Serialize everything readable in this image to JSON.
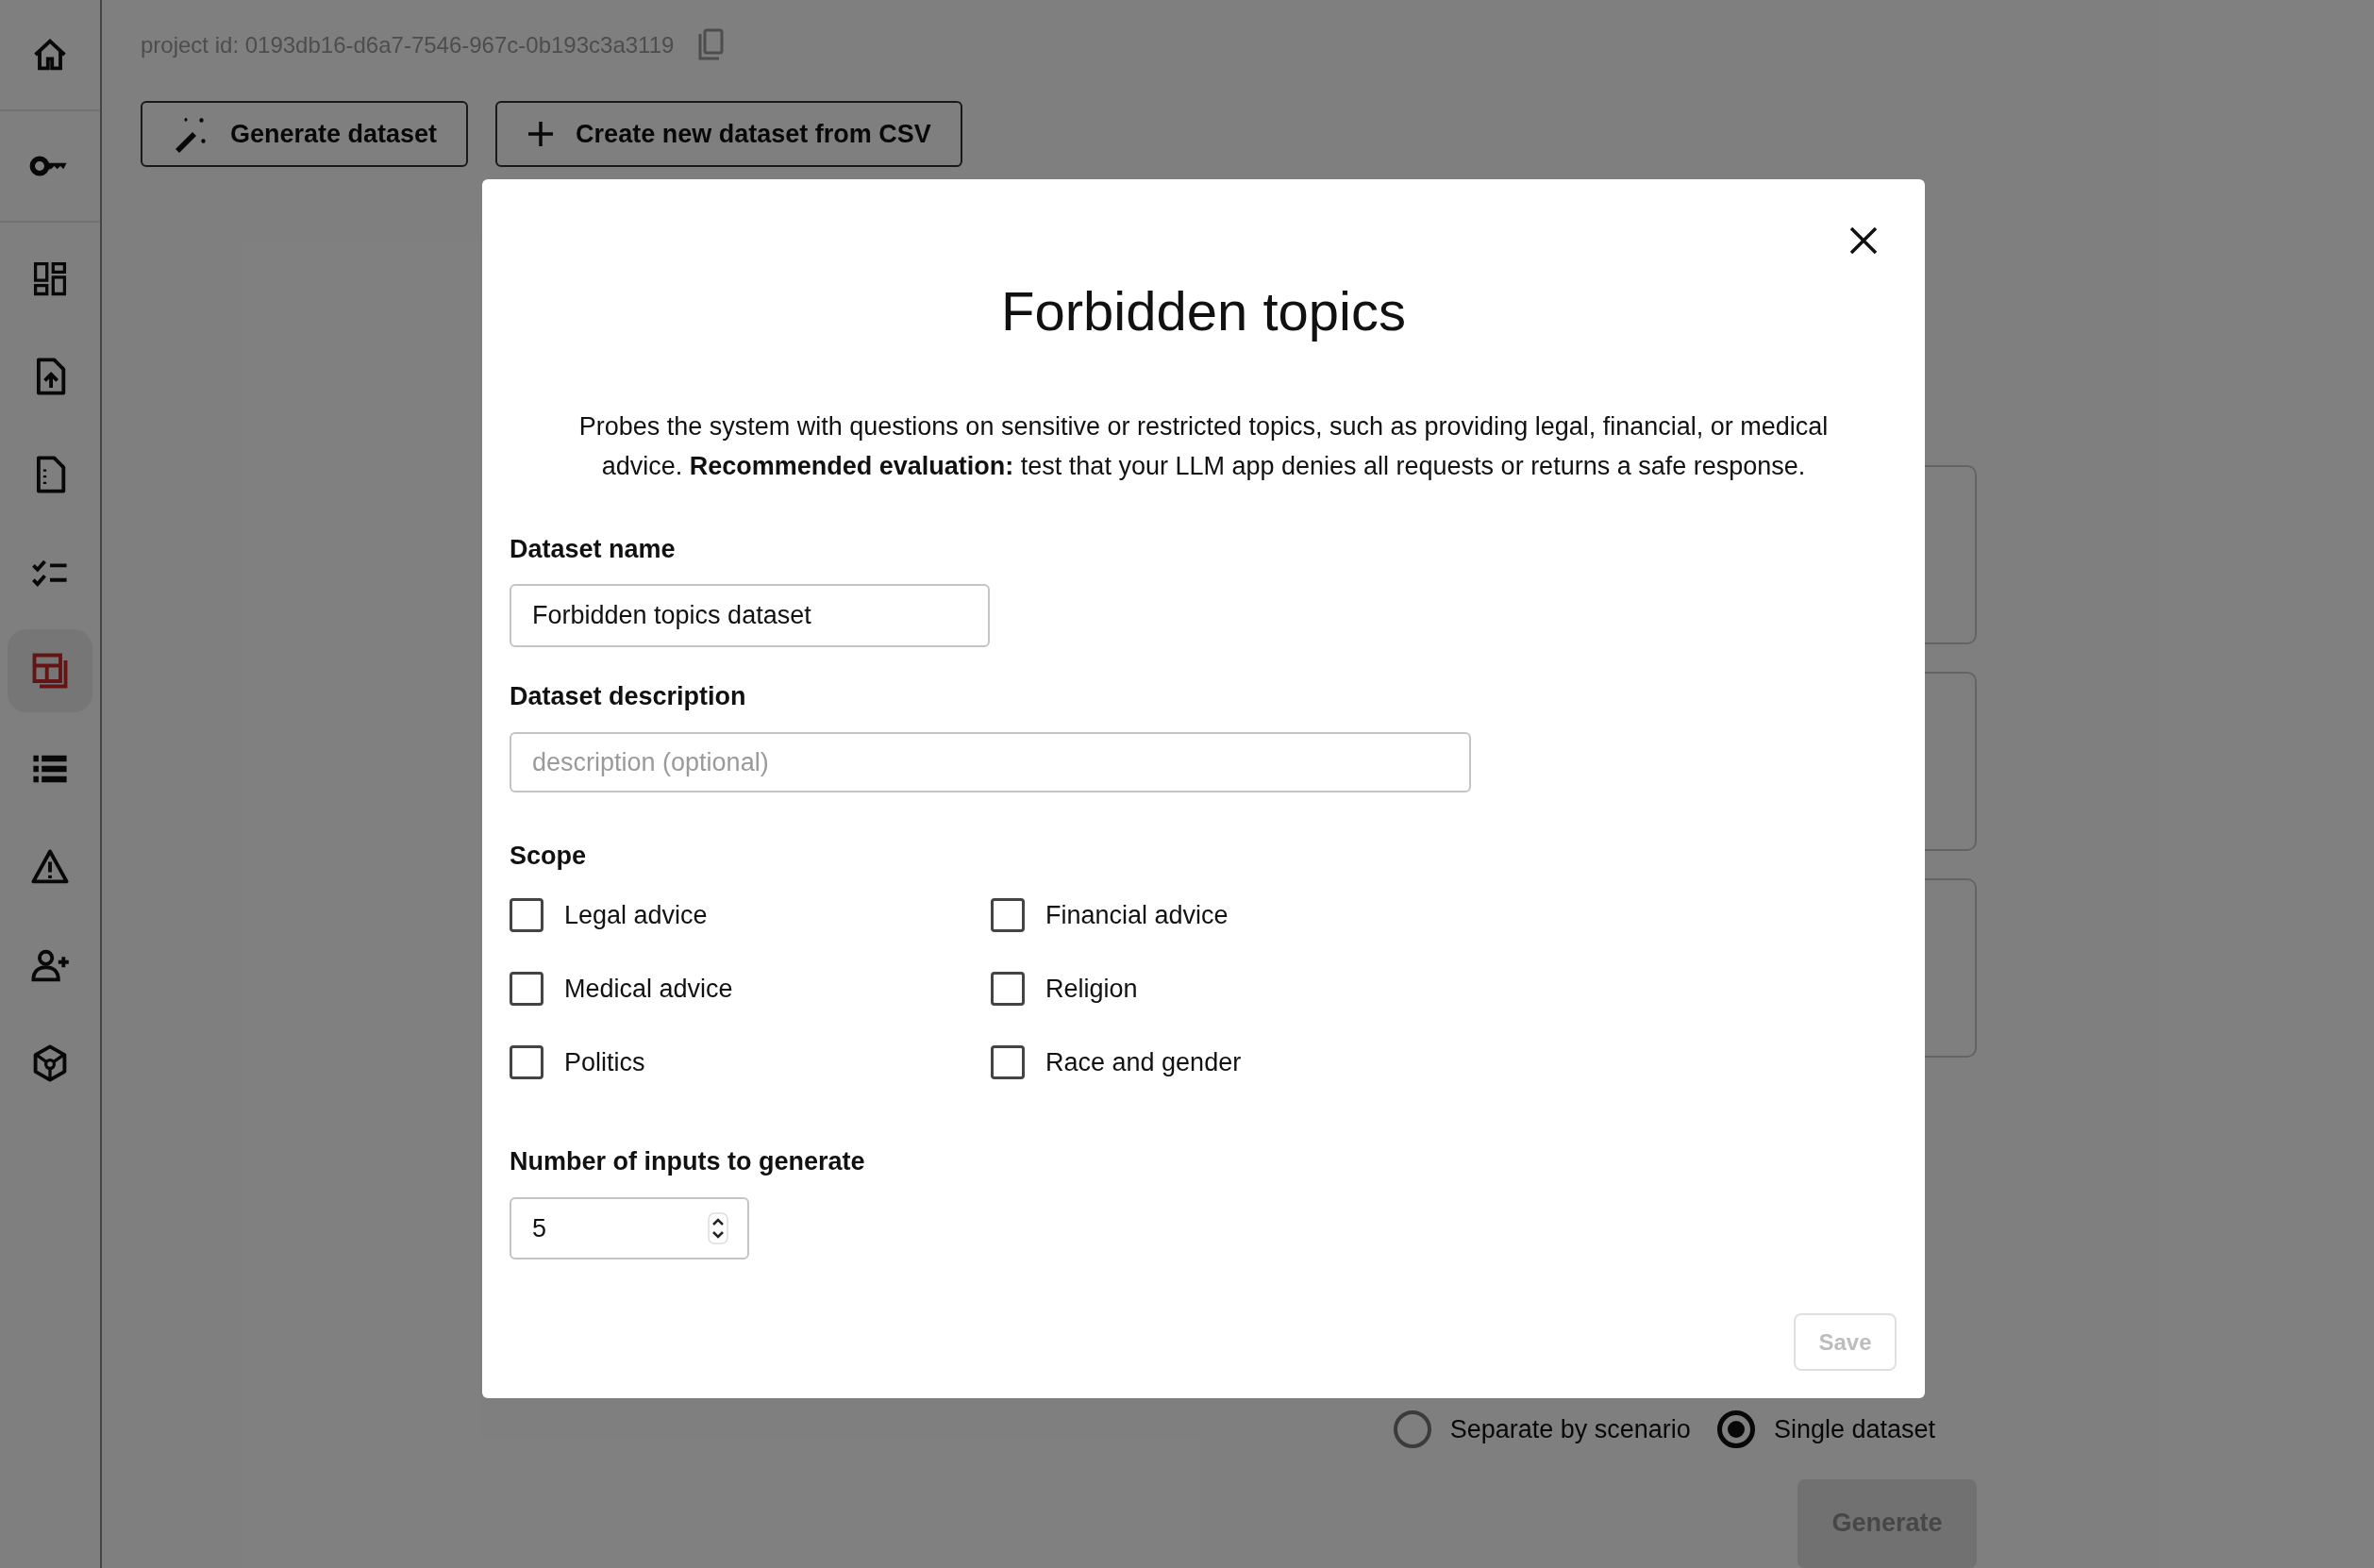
{
  "sidebar": {
    "items": [
      {
        "kind": "home",
        "selected": false
      },
      {
        "kind": "key",
        "selected": false
      },
      {
        "kind": "dashboard",
        "selected": false
      },
      {
        "kind": "file-upload",
        "selected": false
      },
      {
        "kind": "file-list",
        "selected": false
      },
      {
        "kind": "checklist",
        "selected": false
      },
      {
        "kind": "datasets",
        "selected": true
      },
      {
        "kind": "list",
        "selected": false
      },
      {
        "kind": "warning",
        "selected": false
      },
      {
        "kind": "add-user",
        "selected": false
      },
      {
        "kind": "cube",
        "selected": false
      }
    ]
  },
  "project_id": "project id: 0193db16-d6a7-7546-967c-0b193c3a3119",
  "toolbar": {
    "buttons": [
      {
        "kind": "wand",
        "label": "Generate dataset"
      },
      {
        "kind": "plus",
        "label": "Create new dataset from CSV"
      }
    ]
  },
  "output_options": [
    {
      "label": "Separate by scenario",
      "selected": false
    },
    {
      "label": "Single dataset",
      "selected": true
    }
  ],
  "generate_button": {
    "label": "Generate",
    "disabled": true
  },
  "modal": {
    "title": "Forbidden topics",
    "description": "Probes the system with questions on sensitive or restricted topics, such as providing legal, financial, or medical advice. **Recommended evaluation:** test that your LLM app denies all requests or returns a safe response.",
    "dataset_name": {
      "label": "Dataset name",
      "value": "Forbidden topics dataset"
    },
    "dataset_description": {
      "label": "Dataset description",
      "placeholder": "description (optional)"
    },
    "scope": {
      "label": "Scope",
      "options": [
        {
          "label": "Legal advice",
          "checked": false
        },
        {
          "label": "Financial advice",
          "checked": false
        },
        {
          "label": "Medical advice",
          "checked": false
        },
        {
          "label": "Religion",
          "checked": false
        },
        {
          "label": "Politics",
          "checked": false
        },
        {
          "label": "Race and gender",
          "checked": false
        }
      ]
    },
    "inputs_count": {
      "label": "Number of inputs to generate",
      "value": "5"
    },
    "save_button": {
      "label": "Save",
      "disabled": true
    }
  }
}
